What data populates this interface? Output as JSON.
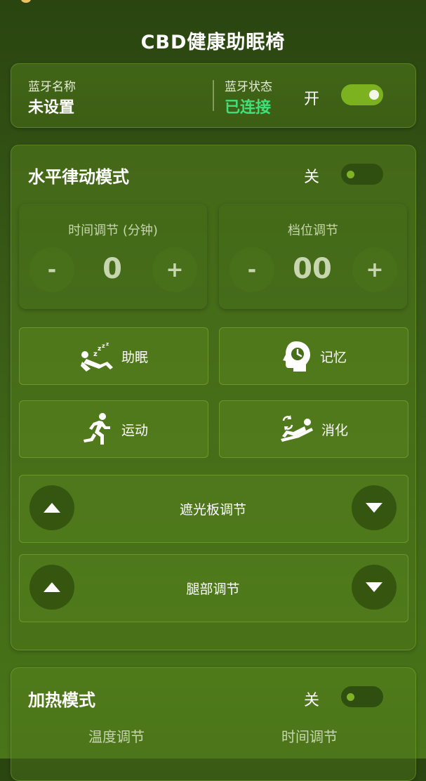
{
  "app": {
    "title": "CBD健康助眠椅"
  },
  "bluetooth": {
    "name_label": "蓝牙名称",
    "name_value": "未设置",
    "status_label": "蓝牙状态",
    "status_value": "已连接",
    "status_color": "#3ee07a",
    "switch_label": "开",
    "switch_on": true
  },
  "rhythm_mode": {
    "title": "水平律动模式",
    "switch_label": "关",
    "switch_on": false,
    "time": {
      "label": "时间调节 (分钟)",
      "value": "0",
      "minus": "-",
      "plus": "+"
    },
    "level": {
      "label": "档位调节",
      "value": "00",
      "minus": "-",
      "plus": "+"
    },
    "functions": [
      {
        "label": "助眠",
        "icon": "sleep-recline-icon"
      },
      {
        "label": "记忆",
        "icon": "head-clock-icon"
      },
      {
        "label": "运动",
        "icon": "running-person-icon"
      },
      {
        "label": "消化",
        "icon": "digestion-recline-icon"
      }
    ],
    "adjustments": [
      {
        "label": "遮光板调节",
        "up_icon": "triangle-up-icon",
        "down_icon": "triangle-down-icon"
      },
      {
        "label": "腿部调节",
        "up_icon": "triangle-up-icon",
        "down_icon": "triangle-down-icon"
      }
    ]
  },
  "heating_mode": {
    "title": "加热模式",
    "switch_label": "关",
    "switch_on": false,
    "temp_label": "温度调节",
    "time_label": "时间调节"
  }
}
